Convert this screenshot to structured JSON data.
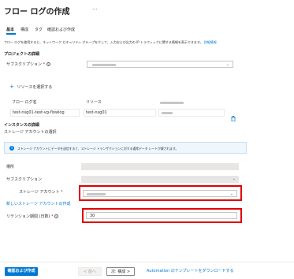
{
  "page": {
    "title": "フロー ログの作成",
    "more": "···"
  },
  "tabs": [
    {
      "label": "基本"
    },
    {
      "label": "構成"
    },
    {
      "label": "タグ"
    },
    {
      "label": "確認および作成"
    }
  ],
  "intro": {
    "text": "フロー ログを使用すると、ネットワーク セキュリティ グループを介して、入力および出力の IP トラフィックに関する情報を表示できます。",
    "link": "詳細情報"
  },
  "project": {
    "heading": "プロジェクトの詳細",
    "subscription_label": "サブスクリプション",
    "required": "*"
  },
  "resource": {
    "add_label": "リソースを選択する",
    "plus": "+",
    "columns": [
      "フロー ログ名",
      "リソース"
    ],
    "row": {
      "flowlog_name": "test-nsg01-test-vg-flowlog",
      "resource": "test-nsg01"
    },
    "delete_icon": "trash-icon"
  },
  "instance": {
    "heading": "インスタンスの詳細",
    "storage_select": "ストレージ アカウントの選択",
    "banner_text": "ストレージ アカウントにデータを送信すると、ストレージ トランザクションに対する通常データ レートが課されます。"
  },
  "form": {
    "location_label": "場所",
    "subscription_label": "サブスクリプション",
    "storage_label": "ストレージ アカウント",
    "required": "*",
    "new_storage_link": "新しいストレージ アカウントの作成",
    "retention_label": "リテンション期間 (日数)",
    "retention_value": "30"
  },
  "footer": {
    "create": "確認および作成",
    "prev": "< 前へ",
    "next": "次: 構成 >",
    "template_link": "Automation のテンプレートをダウンロードする"
  },
  "colors": {
    "accent": "#0078d4",
    "highlight": "#e00000"
  }
}
